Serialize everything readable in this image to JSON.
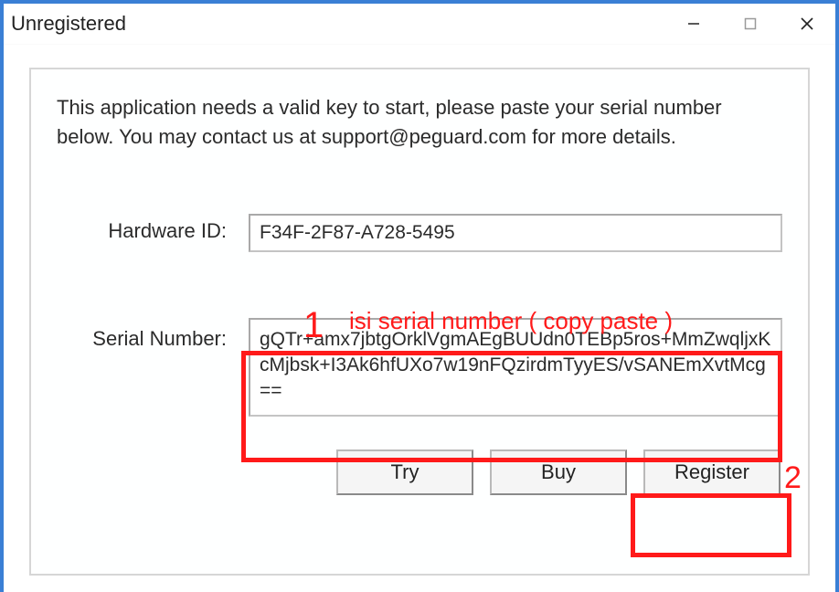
{
  "window": {
    "title": "Unregistered"
  },
  "instructions": "This application needs a valid key to start, please paste your serial number below. You may contact us at support@peguard.com for more details.",
  "fields": {
    "hardware_id": {
      "label": "Hardware ID:",
      "value": "F34F-2F87-A728-5495"
    },
    "serial_number": {
      "label": "Serial Number:",
      "value": "gQTr+amx7jbtgOrklVgmAEgBUUdn0TEBp5ros+MmZwqljxKcMjbsk+I3Ak6hfUXo7w19nFQzirdmTyyES/vSANEmXvtMcg=="
    }
  },
  "buttons": {
    "try": "Try",
    "buy": "Buy",
    "register": "Register"
  },
  "annotations": {
    "hint": "isi serial number ( copy paste )",
    "step1": "1",
    "step2": "2",
    "color": "#ff1a1a"
  },
  "icons": {
    "minimize": "minimize-icon",
    "maximize": "maximize-icon",
    "close": "close-icon"
  }
}
